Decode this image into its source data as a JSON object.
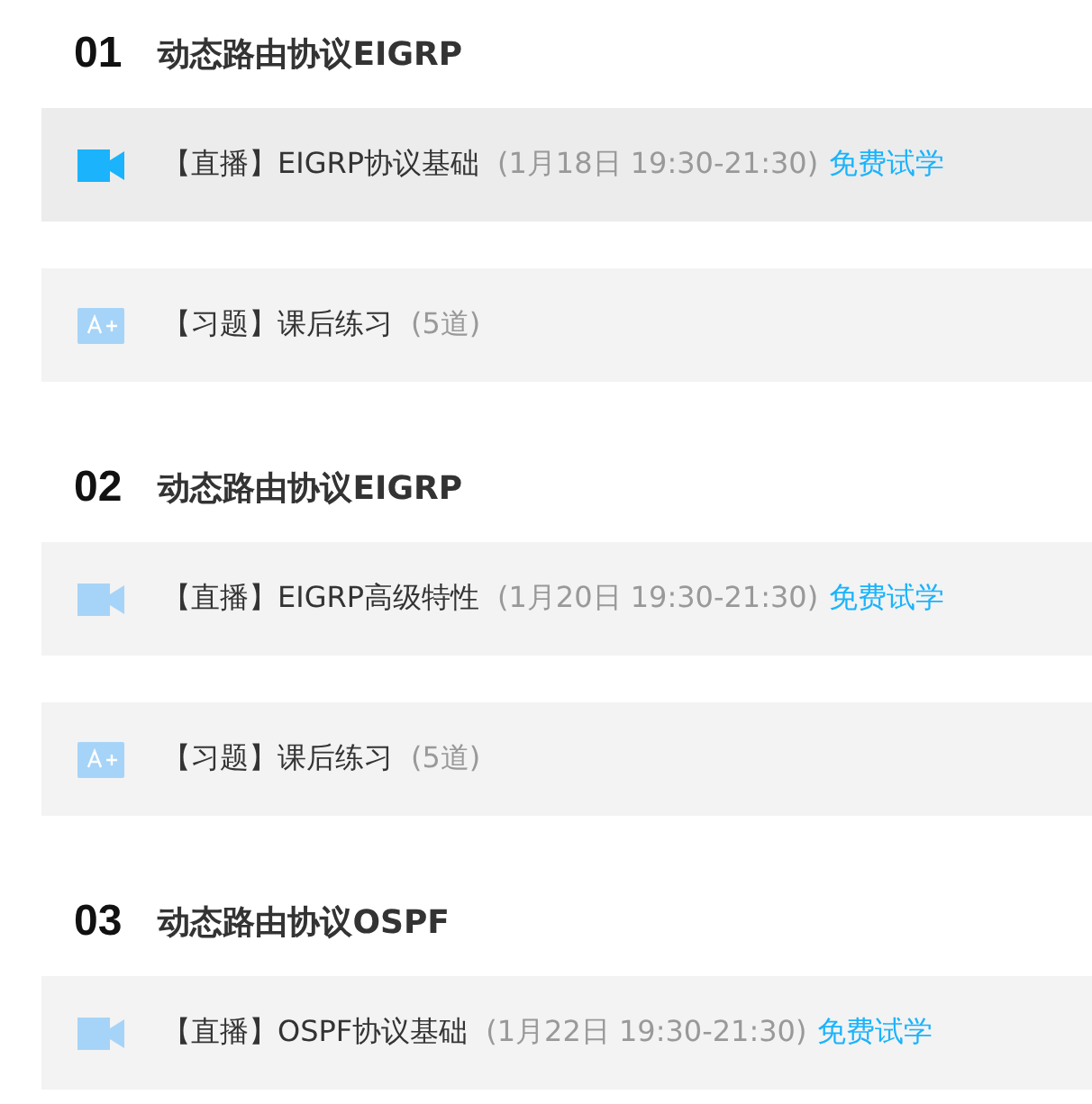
{
  "sections": [
    {
      "number": "01",
      "title": "动态路由协议EIGRP",
      "lessons": [
        {
          "kind": "live",
          "selected": true,
          "title": "【直播】EIGRP协议基础",
          "detail": "(1月18日 19:30-21:30)",
          "link": "免费试学"
        },
        {
          "kind": "exercise",
          "selected": false,
          "title": "【习题】课后练习",
          "detail": "(5道)"
        }
      ]
    },
    {
      "number": "02",
      "title": "动态路由协议EIGRP",
      "lessons": [
        {
          "kind": "live",
          "selected": false,
          "title": "【直播】EIGRP高级特性",
          "detail": "(1月20日 19:30-21:30)",
          "link": "免费试学"
        },
        {
          "kind": "exercise",
          "selected": false,
          "title": "【习题】课后练习",
          "detail": "(5道)"
        }
      ]
    },
    {
      "number": "03",
      "title": "动态路由协议OSPF",
      "lessons": [
        {
          "kind": "live",
          "selected": false,
          "title": "【直播】OSPF协议基础",
          "detail": "(1月22日 19:30-21:30)",
          "link": "免费试学"
        }
      ]
    }
  ]
}
